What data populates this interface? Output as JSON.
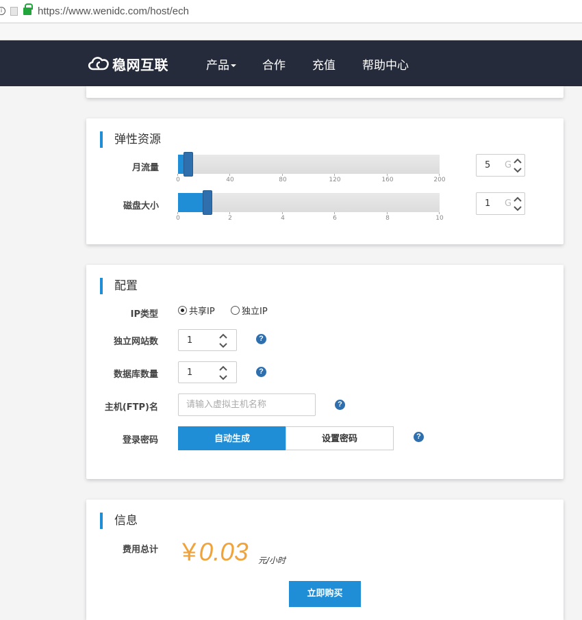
{
  "browser": {
    "url": "https://www.wenidc.com/host/ech"
  },
  "header": {
    "logo_text": "稳网互联",
    "nav": [
      "产品",
      "合作",
      "充值",
      "帮助中心"
    ]
  },
  "elastic": {
    "title": "弹性资源",
    "traffic": {
      "label": "月流量",
      "ticks": [
        "0",
        "40",
        "80",
        "120",
        "160",
        "200"
      ],
      "min": 0,
      "max": 200,
      "value": 5,
      "input_value": "5",
      "unit": "G"
    },
    "disk": {
      "label": "磁盘大小",
      "ticks": [
        "0",
        "2",
        "4",
        "6",
        "8",
        "10"
      ],
      "min": 0,
      "max": 10,
      "value": 1,
      "input_value": "1",
      "unit": "G"
    }
  },
  "config": {
    "title": "配置",
    "ip_type_label": "IP类型",
    "ip_options": [
      "共享IP",
      "独立IP"
    ],
    "ip_selected": 0,
    "sites_label": "独立网站数",
    "sites_value": "1",
    "db_label": "数据库数量",
    "db_value": "1",
    "ftp_label": "主机(FTP)名",
    "ftp_placeholder": "请输入虚拟主机名称",
    "password_label": "登录密码",
    "password_auto": "自动生成",
    "password_set": "设置密码",
    "help_glyph": "?"
  },
  "info": {
    "title": "信息",
    "cost_label": "费用总计",
    "currency": "¥",
    "price": "0.03",
    "price_unit": "元/小时",
    "buy_label": "立即购买"
  },
  "colors": {
    "header_bg": "#262b3c",
    "accent": "#1f8ed7",
    "price": "#f0a33a"
  }
}
